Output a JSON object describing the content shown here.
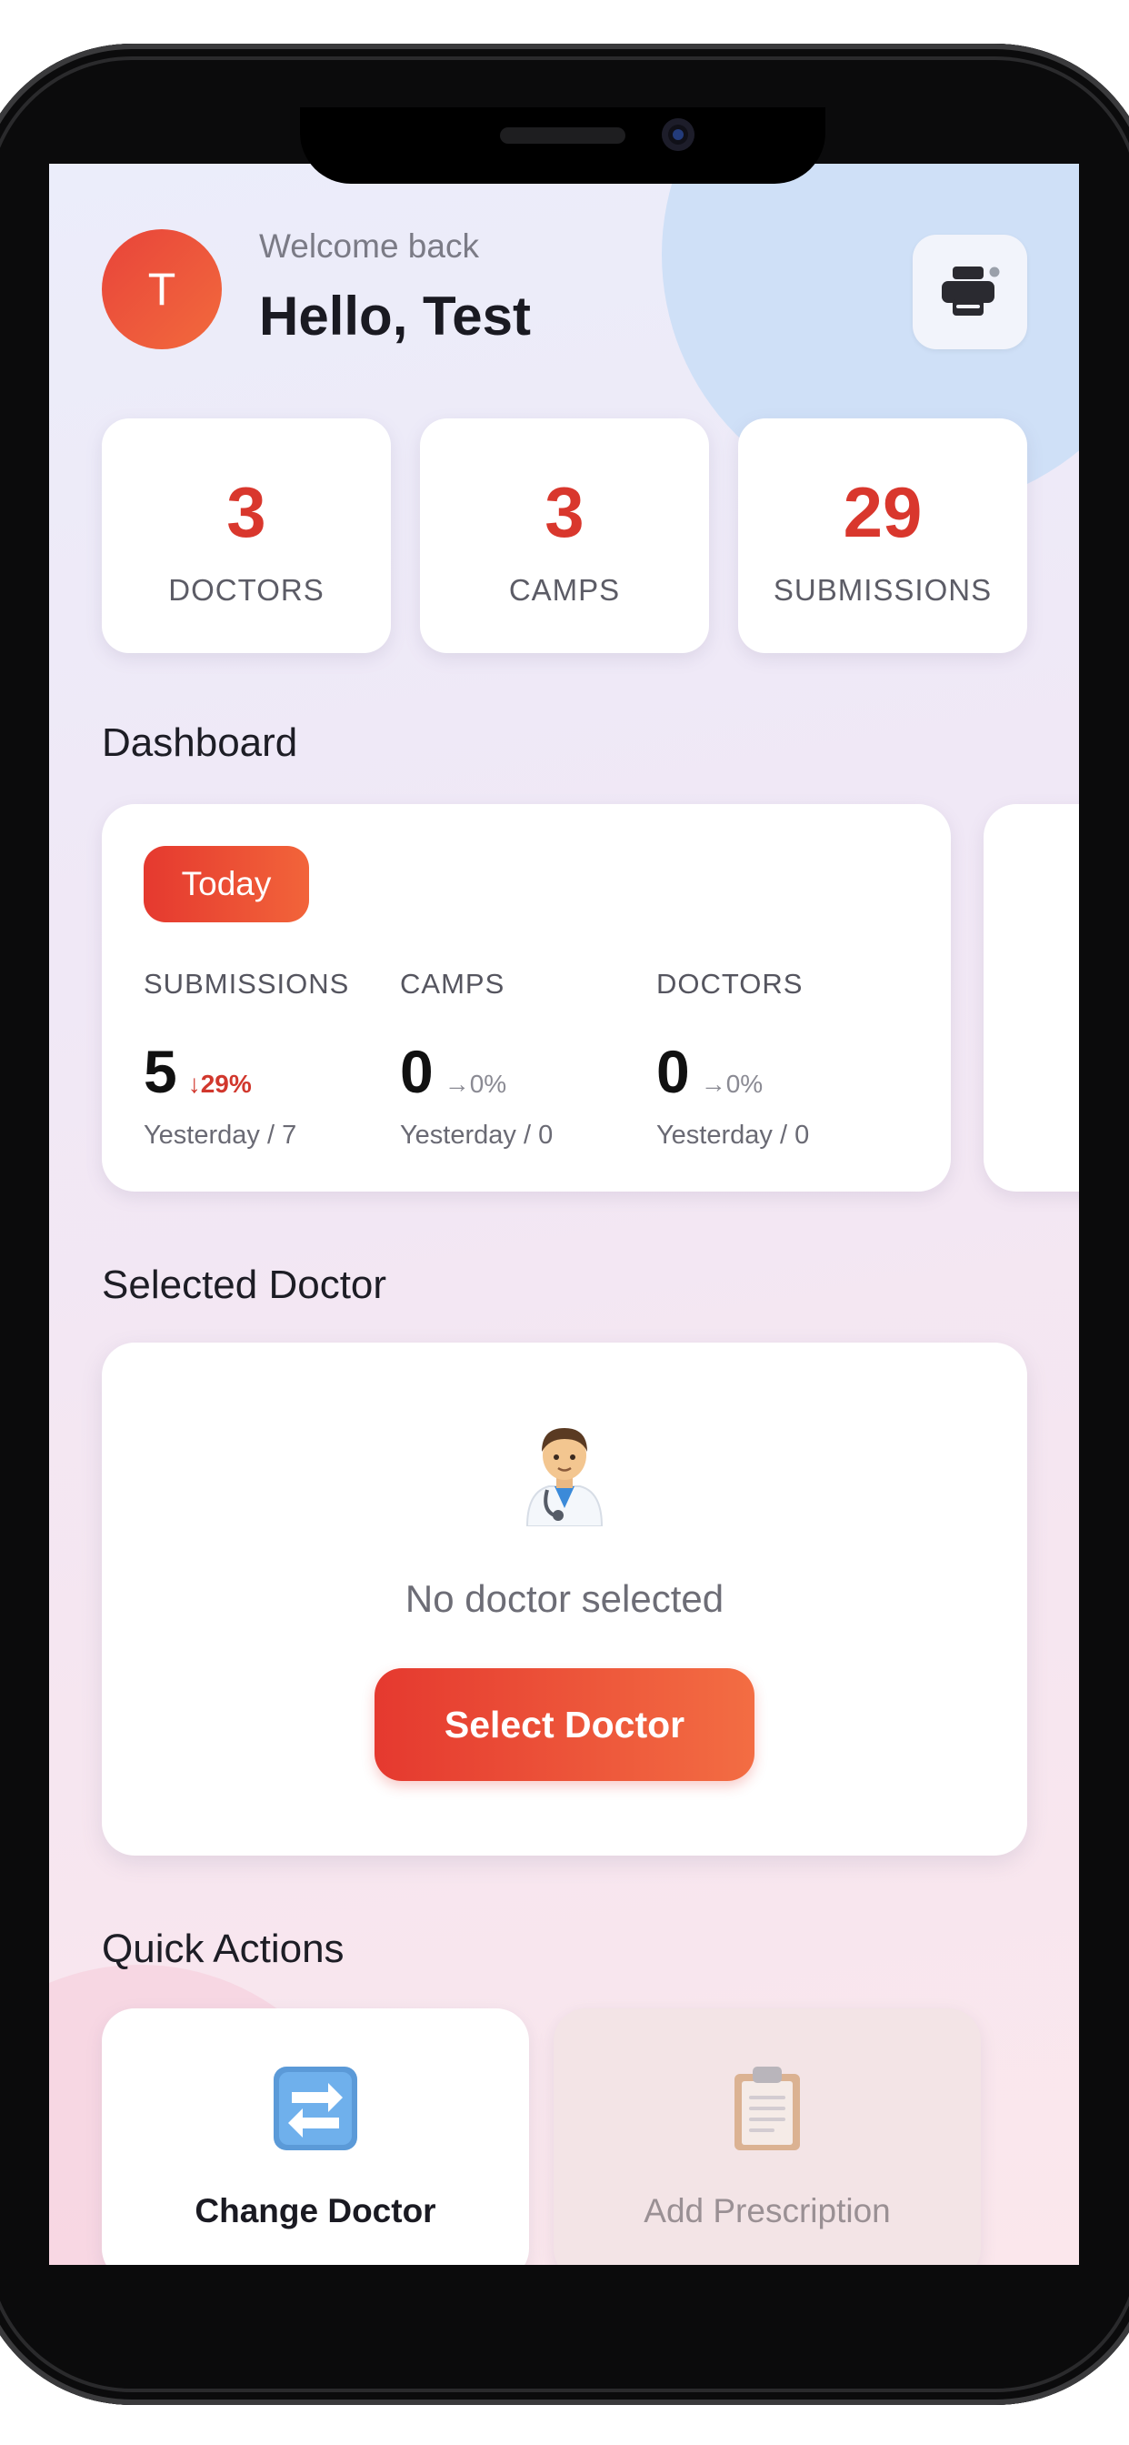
{
  "header": {
    "avatar_initial": "T",
    "welcome": "Welcome back",
    "greeting": "Hello, Test"
  },
  "stats": [
    {
      "value": "3",
      "label": "DOCTORS"
    },
    {
      "value": "3",
      "label": "CAMPS"
    },
    {
      "value": "29",
      "label": "SUBMISSIONS"
    }
  ],
  "dashboard": {
    "title": "Dashboard",
    "period": "Today",
    "metrics": [
      {
        "label": "SUBMISSIONS",
        "value": "5",
        "change": "↓29%",
        "trend": "down",
        "yesterday": "Yesterday / 7"
      },
      {
        "label": "CAMPS",
        "value": "0",
        "change": "→0%",
        "trend": "flat",
        "yesterday": "Yesterday / 0"
      },
      {
        "label": "DOCTORS",
        "value": "0",
        "change": "→0%",
        "trend": "flat",
        "yesterday": "Yesterday / 0"
      }
    ]
  },
  "selected_doctor": {
    "title": "Selected Doctor",
    "icon": "doctor-emoji",
    "empty_text": "No doctor selected",
    "button_label": "Select Doctor"
  },
  "quick_actions": {
    "title": "Quick Actions",
    "items": [
      {
        "label": "Change Doctor",
        "icon": "swap-arrows-icon",
        "enabled": true
      },
      {
        "label": "Add Prescription",
        "icon": "clipboard-icon",
        "enabled": false
      }
    ]
  },
  "colors": {
    "accent": "#e5392f",
    "accent_end": "#f26a3d",
    "stat_value": "#d9372d"
  }
}
